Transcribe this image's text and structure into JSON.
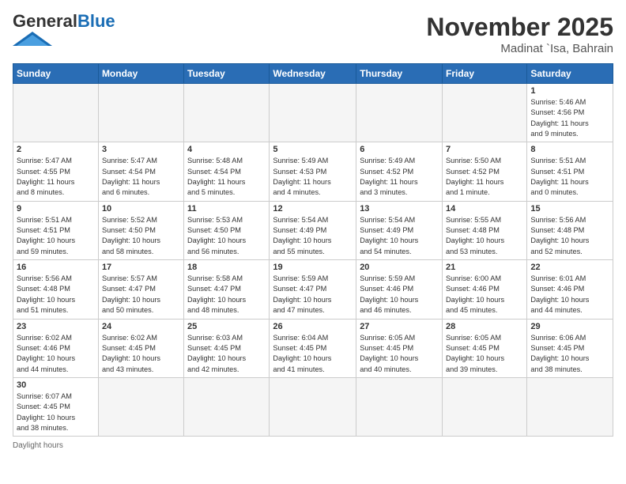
{
  "header": {
    "logo_general": "General",
    "logo_blue": "Blue",
    "month_title": "November 2025",
    "subtitle": "Madinat `Isa, Bahrain"
  },
  "days_of_week": [
    "Sunday",
    "Monday",
    "Tuesday",
    "Wednesday",
    "Thursday",
    "Friday",
    "Saturday"
  ],
  "weeks": [
    [
      {
        "num": "",
        "info": ""
      },
      {
        "num": "",
        "info": ""
      },
      {
        "num": "",
        "info": ""
      },
      {
        "num": "",
        "info": ""
      },
      {
        "num": "",
        "info": ""
      },
      {
        "num": "",
        "info": ""
      },
      {
        "num": "1",
        "info": "Sunrise: 5:46 AM\nSunset: 4:56 PM\nDaylight: 11 hours\nand 9 minutes."
      }
    ],
    [
      {
        "num": "2",
        "info": "Sunrise: 5:47 AM\nSunset: 4:55 PM\nDaylight: 11 hours\nand 8 minutes."
      },
      {
        "num": "3",
        "info": "Sunrise: 5:47 AM\nSunset: 4:54 PM\nDaylight: 11 hours\nand 6 minutes."
      },
      {
        "num": "4",
        "info": "Sunrise: 5:48 AM\nSunset: 4:54 PM\nDaylight: 11 hours\nand 5 minutes."
      },
      {
        "num": "5",
        "info": "Sunrise: 5:49 AM\nSunset: 4:53 PM\nDaylight: 11 hours\nand 4 minutes."
      },
      {
        "num": "6",
        "info": "Sunrise: 5:49 AM\nSunset: 4:52 PM\nDaylight: 11 hours\nand 3 minutes."
      },
      {
        "num": "7",
        "info": "Sunrise: 5:50 AM\nSunset: 4:52 PM\nDaylight: 11 hours\nand 1 minute."
      },
      {
        "num": "8",
        "info": "Sunrise: 5:51 AM\nSunset: 4:51 PM\nDaylight: 11 hours\nand 0 minutes."
      }
    ],
    [
      {
        "num": "9",
        "info": "Sunrise: 5:51 AM\nSunset: 4:51 PM\nDaylight: 10 hours\nand 59 minutes."
      },
      {
        "num": "10",
        "info": "Sunrise: 5:52 AM\nSunset: 4:50 PM\nDaylight: 10 hours\nand 58 minutes."
      },
      {
        "num": "11",
        "info": "Sunrise: 5:53 AM\nSunset: 4:50 PM\nDaylight: 10 hours\nand 56 minutes."
      },
      {
        "num": "12",
        "info": "Sunrise: 5:54 AM\nSunset: 4:49 PM\nDaylight: 10 hours\nand 55 minutes."
      },
      {
        "num": "13",
        "info": "Sunrise: 5:54 AM\nSunset: 4:49 PM\nDaylight: 10 hours\nand 54 minutes."
      },
      {
        "num": "14",
        "info": "Sunrise: 5:55 AM\nSunset: 4:48 PM\nDaylight: 10 hours\nand 53 minutes."
      },
      {
        "num": "15",
        "info": "Sunrise: 5:56 AM\nSunset: 4:48 PM\nDaylight: 10 hours\nand 52 minutes."
      }
    ],
    [
      {
        "num": "16",
        "info": "Sunrise: 5:56 AM\nSunset: 4:48 PM\nDaylight: 10 hours\nand 51 minutes."
      },
      {
        "num": "17",
        "info": "Sunrise: 5:57 AM\nSunset: 4:47 PM\nDaylight: 10 hours\nand 50 minutes."
      },
      {
        "num": "18",
        "info": "Sunrise: 5:58 AM\nSunset: 4:47 PM\nDaylight: 10 hours\nand 48 minutes."
      },
      {
        "num": "19",
        "info": "Sunrise: 5:59 AM\nSunset: 4:47 PM\nDaylight: 10 hours\nand 47 minutes."
      },
      {
        "num": "20",
        "info": "Sunrise: 5:59 AM\nSunset: 4:46 PM\nDaylight: 10 hours\nand 46 minutes."
      },
      {
        "num": "21",
        "info": "Sunrise: 6:00 AM\nSunset: 4:46 PM\nDaylight: 10 hours\nand 45 minutes."
      },
      {
        "num": "22",
        "info": "Sunrise: 6:01 AM\nSunset: 4:46 PM\nDaylight: 10 hours\nand 44 minutes."
      }
    ],
    [
      {
        "num": "23",
        "info": "Sunrise: 6:02 AM\nSunset: 4:46 PM\nDaylight: 10 hours\nand 44 minutes."
      },
      {
        "num": "24",
        "info": "Sunrise: 6:02 AM\nSunset: 4:45 PM\nDaylight: 10 hours\nand 43 minutes."
      },
      {
        "num": "25",
        "info": "Sunrise: 6:03 AM\nSunset: 4:45 PM\nDaylight: 10 hours\nand 42 minutes."
      },
      {
        "num": "26",
        "info": "Sunrise: 6:04 AM\nSunset: 4:45 PM\nDaylight: 10 hours\nand 41 minutes."
      },
      {
        "num": "27",
        "info": "Sunrise: 6:05 AM\nSunset: 4:45 PM\nDaylight: 10 hours\nand 40 minutes."
      },
      {
        "num": "28",
        "info": "Sunrise: 6:05 AM\nSunset: 4:45 PM\nDaylight: 10 hours\nand 39 minutes."
      },
      {
        "num": "29",
        "info": "Sunrise: 6:06 AM\nSunset: 4:45 PM\nDaylight: 10 hours\nand 38 minutes."
      }
    ],
    [
      {
        "num": "30",
        "info": "Sunrise: 6:07 AM\nSunset: 4:45 PM\nDaylight: 10 hours\nand 38 minutes."
      },
      {
        "num": "",
        "info": ""
      },
      {
        "num": "",
        "info": ""
      },
      {
        "num": "",
        "info": ""
      },
      {
        "num": "",
        "info": ""
      },
      {
        "num": "",
        "info": ""
      },
      {
        "num": "",
        "info": ""
      }
    ]
  ],
  "footer": {
    "note": "Daylight hours"
  }
}
